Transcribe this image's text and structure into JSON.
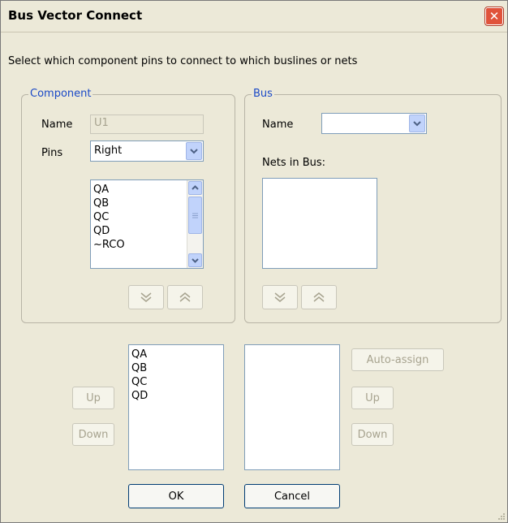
{
  "window": {
    "title": "Bus Vector Connect",
    "close_glyph": "✕"
  },
  "instruction": "Select which component pins to connect to which buslines or nets",
  "component": {
    "legend": "Component",
    "name_label": "Name",
    "name_value": "U1",
    "pins_label": "Pins",
    "pins_selected": "Right",
    "pins_list": [
      "QA",
      "QB",
      "QC",
      "QD",
      "~RCO"
    ]
  },
  "bus": {
    "legend": "Bus",
    "name_label": "Name",
    "name_selected": "",
    "nets_label": "Nets in Bus:",
    "nets_list": []
  },
  "assigned_pins": [
    "QA",
    "QB",
    "QC",
    "QD"
  ],
  "assigned_nets": [],
  "buttons": {
    "pins_up": "Up",
    "pins_down": "Down",
    "auto_assign": "Auto-assign",
    "nets_up": "Up",
    "nets_down": "Down",
    "ok": "OK",
    "cancel": "Cancel"
  },
  "icons": {
    "move_down": "double-chevron-down-icon",
    "move_up": "double-chevron-up-icon",
    "dropdown": "chevron-down-icon",
    "scroll_up": "scroll-up-arrow-icon",
    "scroll_down": "scroll-down-arrow-icon"
  },
  "colors": {
    "dialog_bg": "#ece9d8",
    "legend_blue": "#1a49c7",
    "close_red": "#e0533b",
    "disabled_text": "#a7a38f"
  }
}
